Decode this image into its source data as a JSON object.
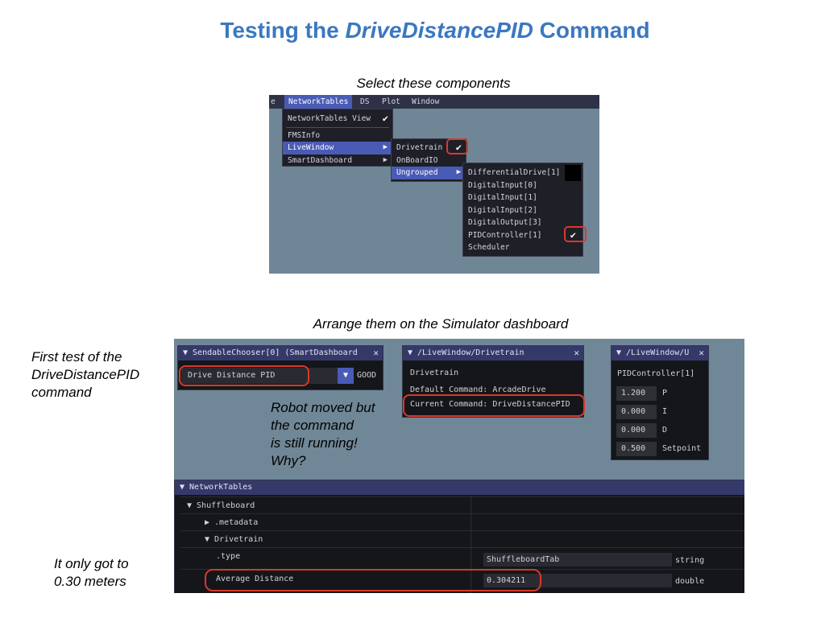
{
  "slide": {
    "title_prefix": "Testing the ",
    "title_emph": "DriveDistancePID",
    "title_suffix": " Command",
    "caption_select": "Select these components",
    "caption_arrange": "Arrange them on the Simulator dashboard",
    "note_first_test": [
      "First test of the",
      "DriveDistancePID",
      "command"
    ],
    "note_distance": [
      "It only got to",
      "0.30 meters"
    ],
    "note_robot_moved": [
      "Robot moved but",
      "the command",
      "is still running!",
      "Why?"
    ]
  },
  "menu_screenshot": {
    "menubar": [
      "e",
      "NetworkTables",
      "DS",
      "Plot",
      "Window"
    ],
    "active_menu": "NetworkTables",
    "networktables_menu": [
      {
        "label": "NetworkTables View",
        "checked": true
      },
      {
        "label": "FMSInfo"
      },
      {
        "label": "LiveWindow",
        "submenu": true,
        "highlighted": true
      },
      {
        "label": "SmartDashboard",
        "submenu": true
      }
    ],
    "livewindow_menu": [
      {
        "label": "Drivetrain",
        "checked": true
      },
      {
        "label": "OnBoardIO"
      },
      {
        "label": "Ungrouped",
        "submenu": true,
        "highlighted": true
      }
    ],
    "ungrouped_menu": [
      {
        "label": "DifferentialDrive[1]"
      },
      {
        "label": "DigitalInput[0]"
      },
      {
        "label": "DigitalInput[1]"
      },
      {
        "label": "DigitalInput[2]"
      },
      {
        "label": "DigitalOutput[3]"
      },
      {
        "label": "PIDController[1]",
        "checked": true
      },
      {
        "label": "Scheduler"
      }
    ],
    "check_glyph": "✔",
    "submenu_glyph": "▶"
  },
  "dashboard_screenshot": {
    "chooser": {
      "title": "▼ SendableChooser[0] (SmartDashboard",
      "close": "✕",
      "selected": "Drive Distance PID",
      "dropdown_glyph": "▼",
      "status": "GOOD"
    },
    "drivetrain": {
      "title": "▼ /LiveWindow/Drivetrain",
      "close": "✕",
      "name": "Drivetrain",
      "default_command": "Default Command: ArcadeDrive",
      "current_command": "Current Command: DriveDistancePID"
    },
    "pid": {
      "title": "▼ /LiveWindow/U",
      "close": "✕",
      "name": "PIDController[1]",
      "rows": [
        {
          "value": "1.200",
          "label": "P"
        },
        {
          "value": "0.000",
          "label": "I"
        },
        {
          "value": "0.000",
          "label": "D"
        },
        {
          "value": "0.500",
          "label": "Setpoint"
        }
      ]
    },
    "networktables": {
      "title": "▼ NetworkTables",
      "shuffleboard": "▼ Shuffleboard",
      "metadata": "▶ .metadata",
      "drivetrain": "▼ Drivetrain",
      "type_key": ".type",
      "type_value": "ShuffleboardTab",
      "type_type": "string",
      "avg_key": "Average Distance",
      "avg_value": "0.304211",
      "avg_type": "double"
    }
  },
  "colors": {
    "title_blue": "#3a78c0",
    "highlight_red": "#d9382b",
    "menu_highlight": "#4a5bb5",
    "sim_background": "#708797"
  }
}
